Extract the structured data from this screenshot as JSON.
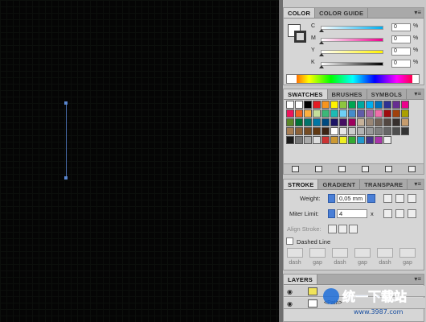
{
  "color_panel": {
    "tabs": [
      "COLOR",
      "COLOR GUIDE"
    ],
    "sliders": [
      {
        "label": "C",
        "value": "0",
        "unit": "%"
      },
      {
        "label": "M",
        "value": "0",
        "unit": "%"
      },
      {
        "label": "Y",
        "value": "0",
        "unit": "%"
      },
      {
        "label": "K",
        "value": "0",
        "unit": "%"
      }
    ]
  },
  "swatches_panel": {
    "tabs": [
      "SWATCHES",
      "BRUSHES",
      "SYMBOLS"
    ]
  },
  "stroke_panel": {
    "tabs": [
      "STROKE",
      "GRADIENT",
      "TRANSPARE"
    ],
    "weight_label": "Weight:",
    "weight_value": "0,05 mm",
    "miter_label": "Miter Limit:",
    "miter_value": "4",
    "miter_unit": "x",
    "align_label": "Align Stroke:",
    "dashed_label": "Dashed Line",
    "dash_labels": [
      "dash",
      "gap",
      "dash",
      "gap",
      "dash",
      "gap"
    ]
  },
  "layers_panel": {
    "tabs": [
      "LAYERS"
    ],
    "sublayer_label": "<Path>"
  },
  "watermark": {
    "text": "统一下载站",
    "url": "www.3987.com"
  },
  "colors": {
    "accent": "#4a7fd6",
    "canvas": "#050505",
    "path": "#4a6fb0"
  }
}
